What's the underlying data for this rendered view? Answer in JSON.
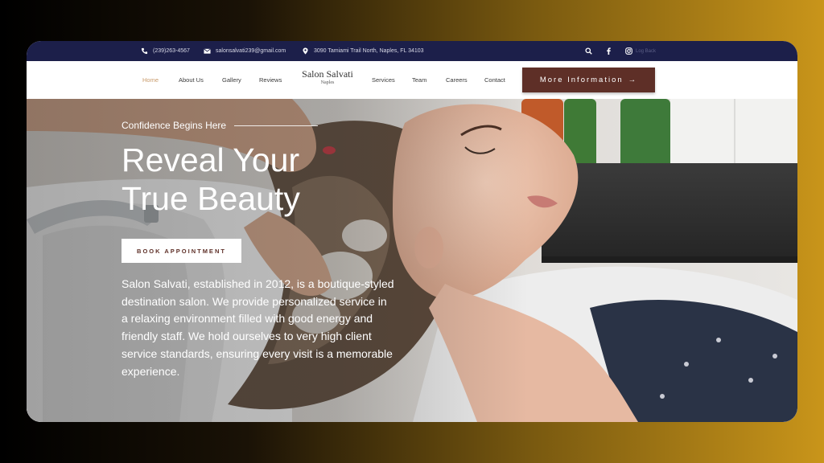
{
  "topbar": {
    "phone": "(239)263-4567",
    "email": "salonsalvati239@gmail.com",
    "address": "3090 Tamiami Trail North, Naples, FL 34103",
    "right_link": "Log Back",
    "icons": [
      "phone-icon",
      "envelope-icon",
      "location-pin-icon",
      "search-icon",
      "facebook-icon",
      "instagram-icon"
    ]
  },
  "nav": {
    "items": [
      "Home",
      "About Us",
      "Gallery",
      "Reviews",
      "Services",
      "Team",
      "Careers",
      "Contact"
    ],
    "active": "Home",
    "logo_title": "Salon Salvati",
    "logo_sub": "Naples",
    "cta_label": "More Information",
    "cta_arrow": "→"
  },
  "hero": {
    "eyebrow": "Confidence Begins Here",
    "headline_line1": "Reveal Your",
    "headline_line2": "True Beauty",
    "button_label": "BOOK APPOINTMENT",
    "description": "Salon Salvati, established in 2012, is a boutique-styled destination salon. We provide personalized service in a relaxing environment filled with good energy and friendly staff. We hold ourselves to very high client service standards, ensuring every visit is a memorable experience."
  },
  "colors": {
    "topbar_bg": "#1c1f4a",
    "accent_brown": "#5e2f27",
    "active_link": "#c89a6a"
  }
}
